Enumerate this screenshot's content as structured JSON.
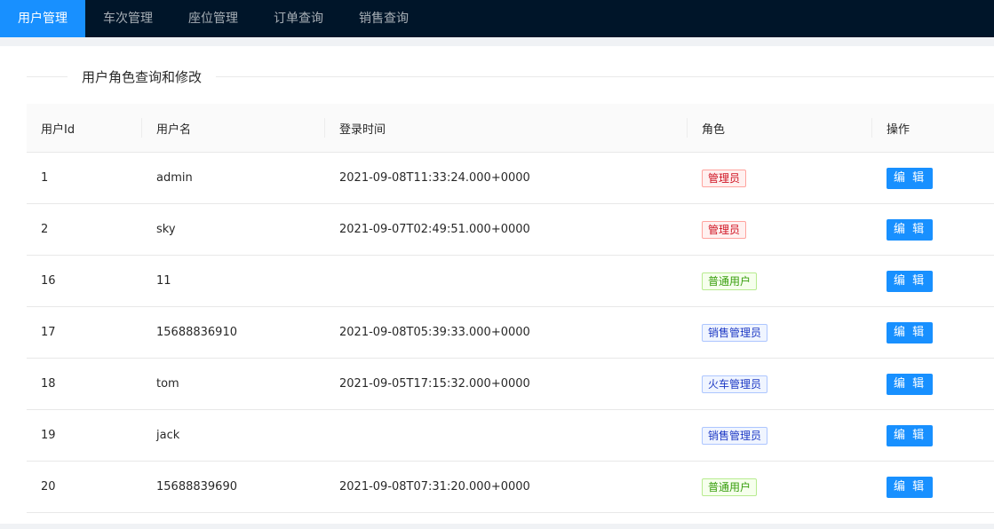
{
  "nav": {
    "items": [
      {
        "label": "用户管理",
        "active": true
      },
      {
        "label": "车次管理",
        "active": false
      },
      {
        "label": "座位管理",
        "active": false
      },
      {
        "label": "订单查询",
        "active": false
      },
      {
        "label": "销售查询",
        "active": false
      }
    ]
  },
  "section": {
    "title": "用户角色查询和修改"
  },
  "table": {
    "columns": [
      "用户Id",
      "用户名",
      "登录时间",
      "角色",
      "操作"
    ],
    "rows": [
      {
        "id": "1",
        "username": "admin",
        "login_time": "2021-09-08T11:33:24.000+0000",
        "role": "管理员",
        "role_color": "red",
        "action": "编 辑"
      },
      {
        "id": "2",
        "username": "sky",
        "login_time": "2021-09-07T02:49:51.000+0000",
        "role": "管理员",
        "role_color": "red",
        "action": "编 辑"
      },
      {
        "id": "16",
        "username": "11",
        "login_time": "",
        "role": "普通用户",
        "role_color": "green",
        "action": "编 辑"
      },
      {
        "id": "17",
        "username": "15688836910",
        "login_time": "2021-09-08T05:39:33.000+0000",
        "role": "销售管理员",
        "role_color": "blue",
        "action": "编 辑"
      },
      {
        "id": "18",
        "username": "tom",
        "login_time": "2021-09-05T17:15:32.000+0000",
        "role": "火车管理员",
        "role_color": "blue",
        "action": "编 辑"
      },
      {
        "id": "19",
        "username": "jack",
        "login_time": "",
        "role": "销售管理员",
        "role_color": "blue",
        "action": "编 辑"
      },
      {
        "id": "20",
        "username": "15688839690",
        "login_time": "2021-09-08T07:31:20.000+0000",
        "role": "普通用户",
        "role_color": "green",
        "action": "编 辑"
      }
    ]
  },
  "colors": {
    "nav_bg": "#001529",
    "accent": "#1890ff"
  }
}
